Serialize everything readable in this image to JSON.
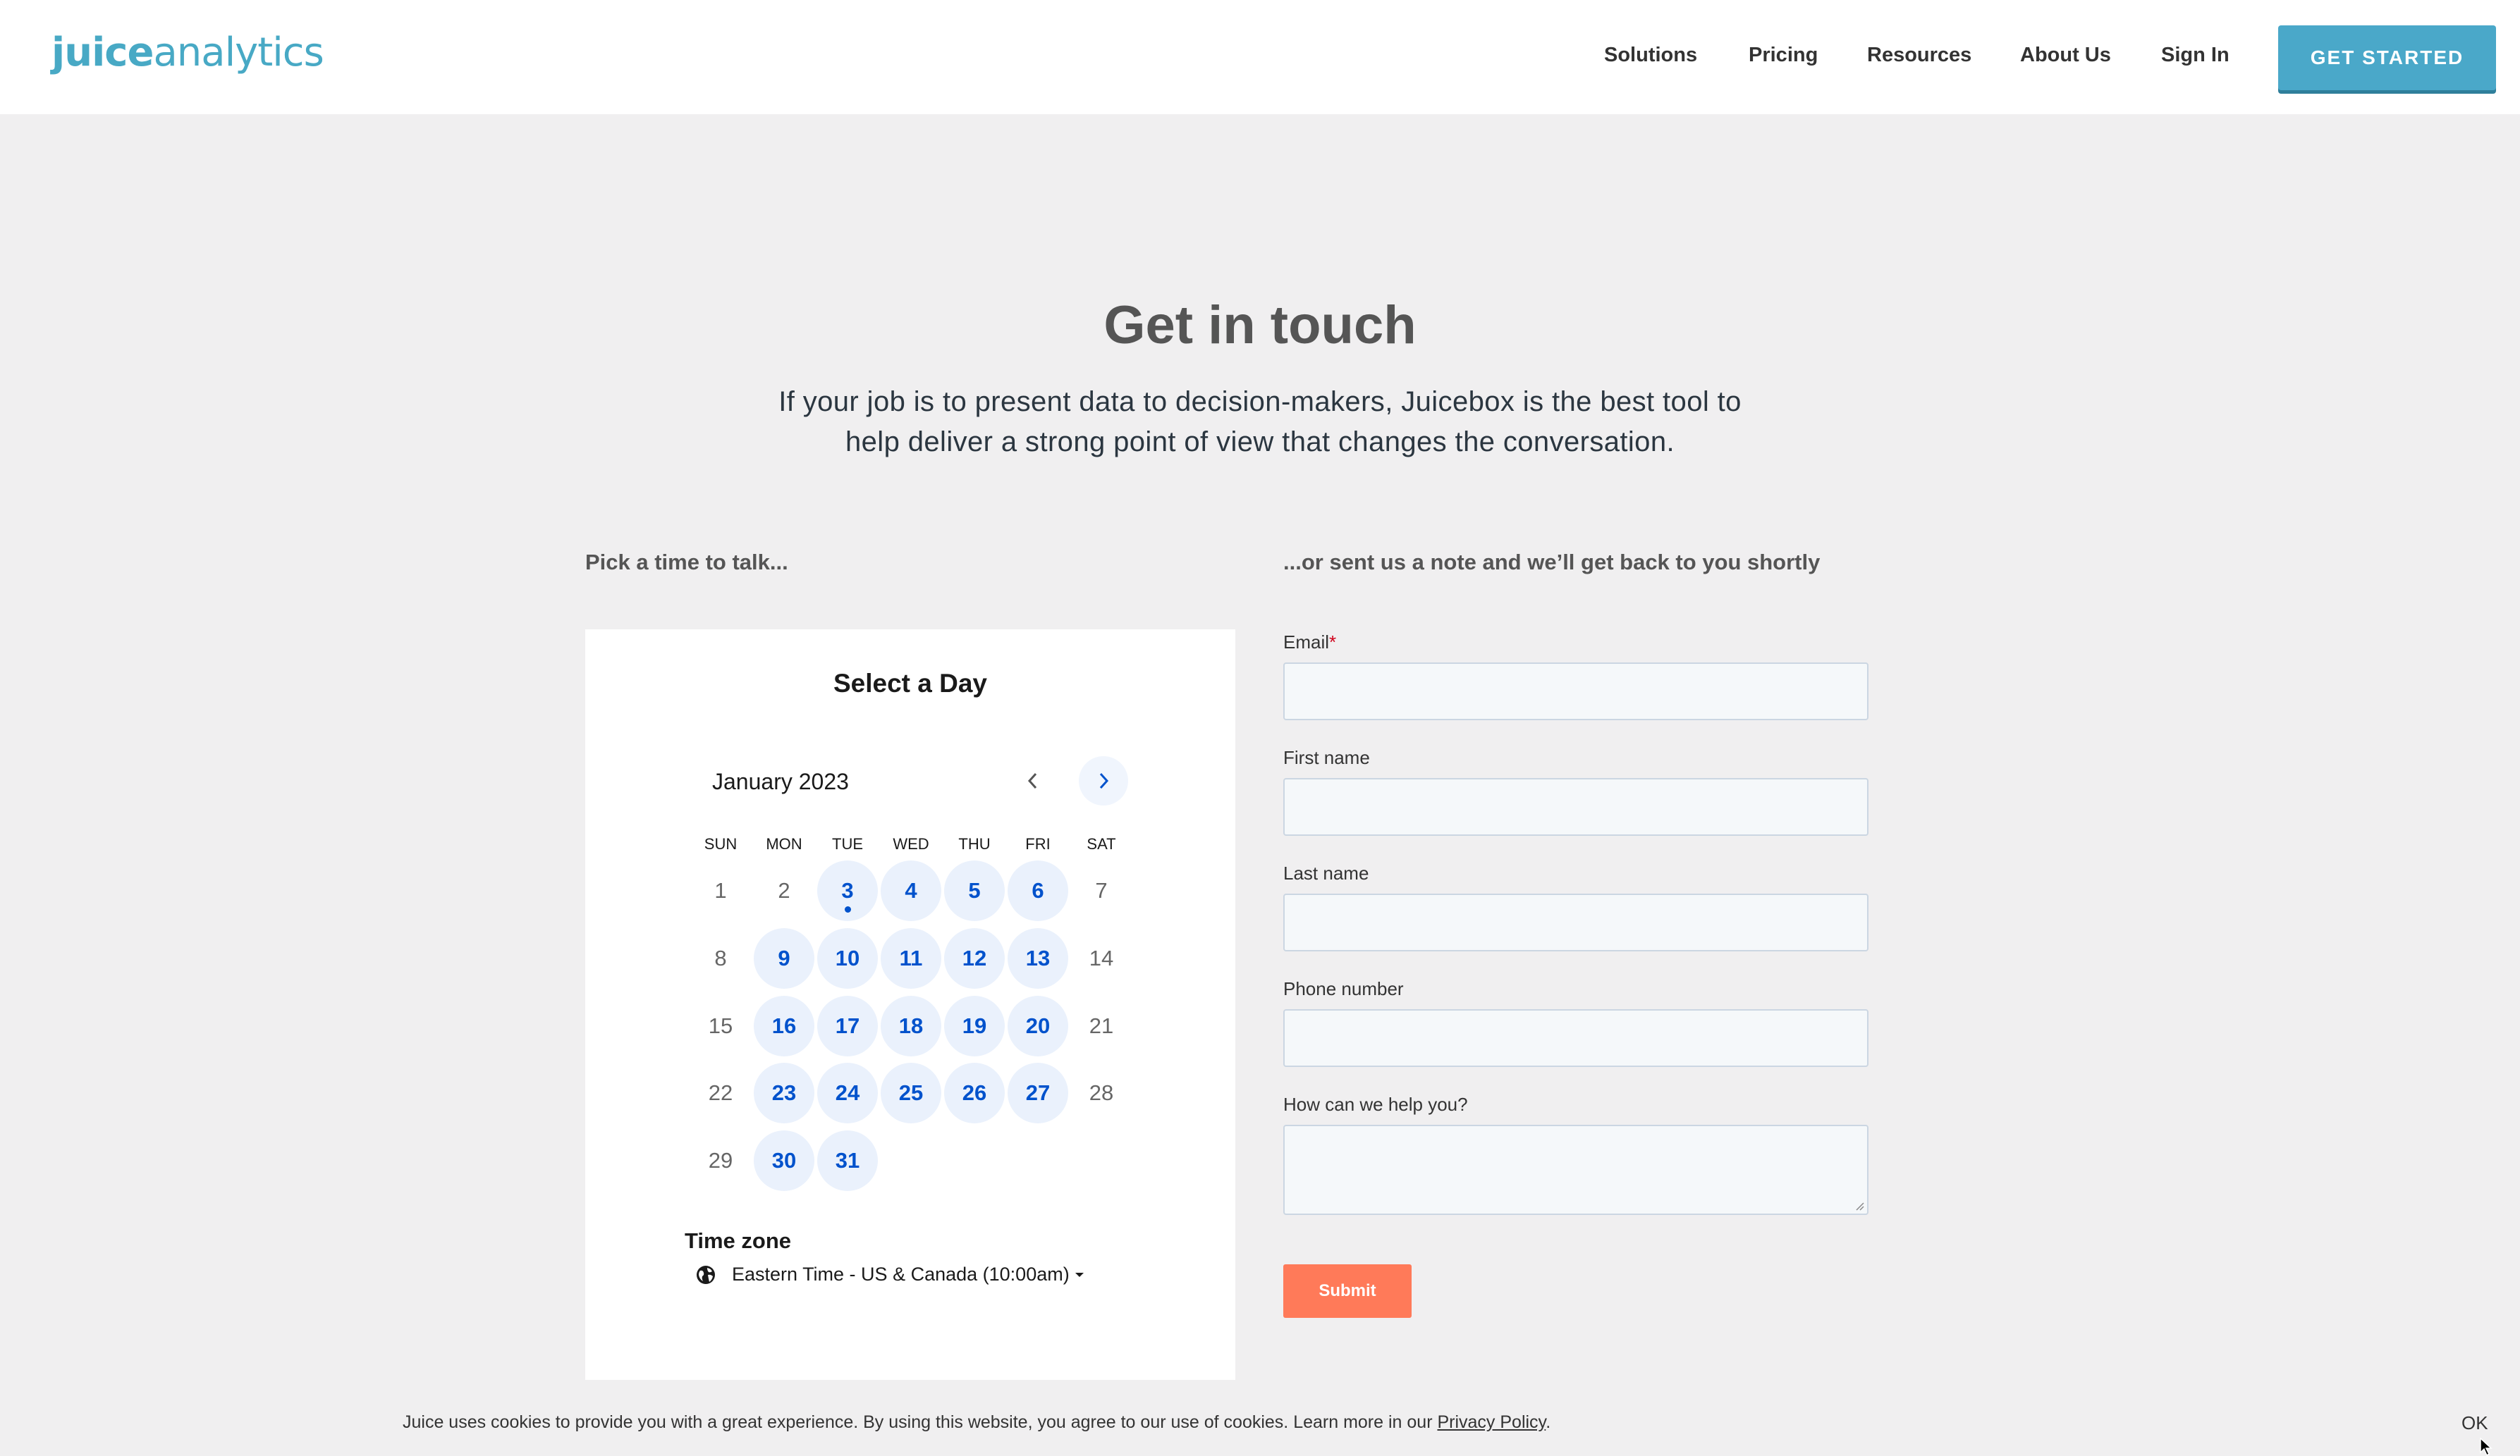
{
  "header": {
    "logo_bold": "juice",
    "logo_light": "analytics",
    "nav": [
      {
        "label": "Solutions"
      },
      {
        "label": "Pricing"
      },
      {
        "label": "Resources"
      },
      {
        "label": "About Us"
      },
      {
        "label": "Sign In"
      }
    ],
    "cta_label": "GET STARTED"
  },
  "hero": {
    "title": "Get in touch",
    "subtitle_line1": "If your job is to present data to decision-makers, Juicebox is the best tool to",
    "subtitle_line2": "help deliver a strong point of view that changes the conversation."
  },
  "left_label": "Pick a time to talk...",
  "right_label": "...or sent us a note and we’ll get back to you shortly",
  "calendar": {
    "title": "Select a Day",
    "month": "January 2023",
    "weekdays": [
      "SUN",
      "MON",
      "TUE",
      "WED",
      "THU",
      "FRI",
      "SAT"
    ],
    "weeks": [
      [
        "1",
        "2",
        "3",
        "4",
        "5",
        "6",
        "7"
      ],
      [
        "8",
        "9",
        "10",
        "11",
        "12",
        "13",
        "14"
      ],
      [
        "15",
        "16",
        "17",
        "18",
        "19",
        "20",
        "21"
      ],
      [
        "22",
        "23",
        "24",
        "25",
        "26",
        "27",
        "28"
      ],
      [
        "29",
        "30",
        "31",
        "",
        "",
        "",
        ""
      ]
    ],
    "available": [
      "3",
      "4",
      "5",
      "6",
      "9",
      "10",
      "11",
      "12",
      "13",
      "16",
      "17",
      "18",
      "19",
      "20",
      "23",
      "24",
      "25",
      "26",
      "27",
      "30",
      "31"
    ],
    "today": "3",
    "timezone_label": "Time zone",
    "timezone_value": "Eastern Time - US & Canada (10:00am)"
  },
  "form": {
    "email_label": "Email",
    "required_mark": "*",
    "first_name_label": "First name",
    "last_name_label": "Last name",
    "phone_label": "Phone number",
    "help_label": "How can we help you?",
    "email_value": "",
    "first_name_value": "",
    "last_name_value": "",
    "phone_value": "",
    "help_value": "",
    "submit_label": "Submit"
  },
  "cookie": {
    "text": "Juice uses cookies to provide you with a great experience. By using this website, you agree to our use of cookies.  Learn more in our ",
    "link": "Privacy Policy",
    "period": ".",
    "ok": "OK"
  },
  "colors": {
    "brand": "#48a9c5",
    "cta": "#4aa8c9",
    "calendar_accent": "#0052cc",
    "submit": "#ff7a59",
    "background": "#f0eff0"
  },
  "icons": {
    "prev": "chevron-left-icon",
    "next": "chevron-right-icon",
    "timezone": "globe-icon",
    "dropdown": "caret-down-icon"
  }
}
